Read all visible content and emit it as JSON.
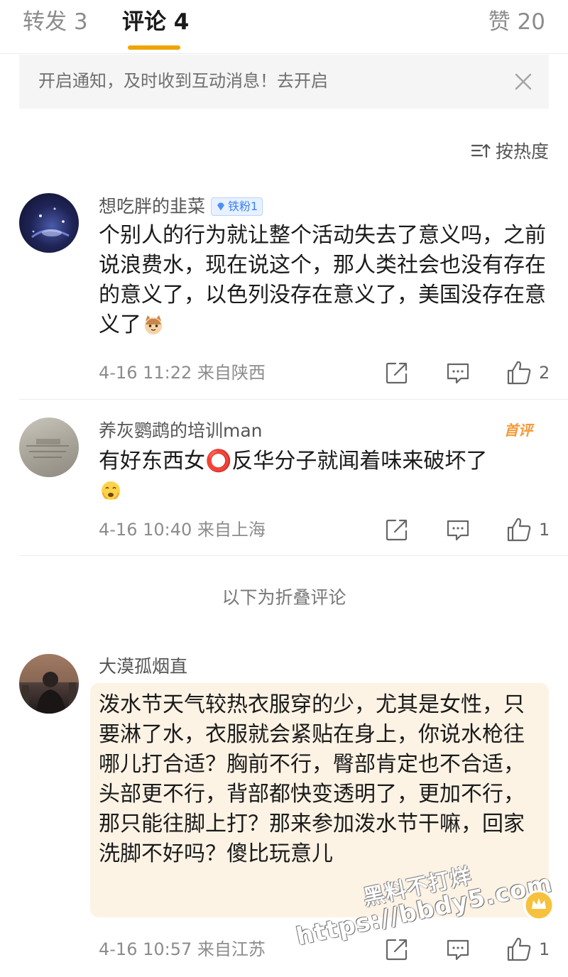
{
  "tabs": {
    "repost": "转发 3",
    "comment": "评论 4",
    "likes": "赞 20"
  },
  "notice": {
    "text": "开启通知，及时收到互动消息！去开启"
  },
  "sort": {
    "label": "按热度"
  },
  "comments": [
    {
      "username": "想吃胖的韭菜",
      "badge": "铁粉1",
      "text": "个别人的行为就让整个活动失去了意义吗，之前说浪费水，现在说这个，那人类社会也没有存在的意义了，以色列没存在意义了，美国没存在意义了",
      "emoji": "cat-emoji",
      "meta": "4-16 11:22  来自陕西",
      "likes": "2"
    },
    {
      "username": "养灰鹦鹉的培训man",
      "tag": "首评",
      "text": "有好东西女⭕反华分子就闻着味来破坏了",
      "emoji": "crying-emoji",
      "meta": "4-16 10:40  来自上海",
      "likes": "1"
    },
    {
      "username": "大漠孤烟直",
      "text": "泼水节天气较热衣服穿的少，尤其是女性，只要淋了水，衣服就会紧贴在身上，你说水枪往哪儿打合适？胸前不行，臀部肯定也不合适，头部更不行，背部都快变透明了，更加不行，那只能往脚上打？那来参加泼水节干嘛，回家洗脚不好吗？傻比玩意儿",
      "meta": "4-16 10:57  来自江苏",
      "likes": "1"
    }
  ],
  "folded": {
    "label": "以下为折叠评论"
  },
  "watermark": {
    "line1": "黑料不打烊",
    "line2": "https://bbdy5.com"
  },
  "colors": {
    "accent": "#f0a400",
    "highlight_bg": "#fdf3e5",
    "notice_bg": "#f5f5f5"
  }
}
